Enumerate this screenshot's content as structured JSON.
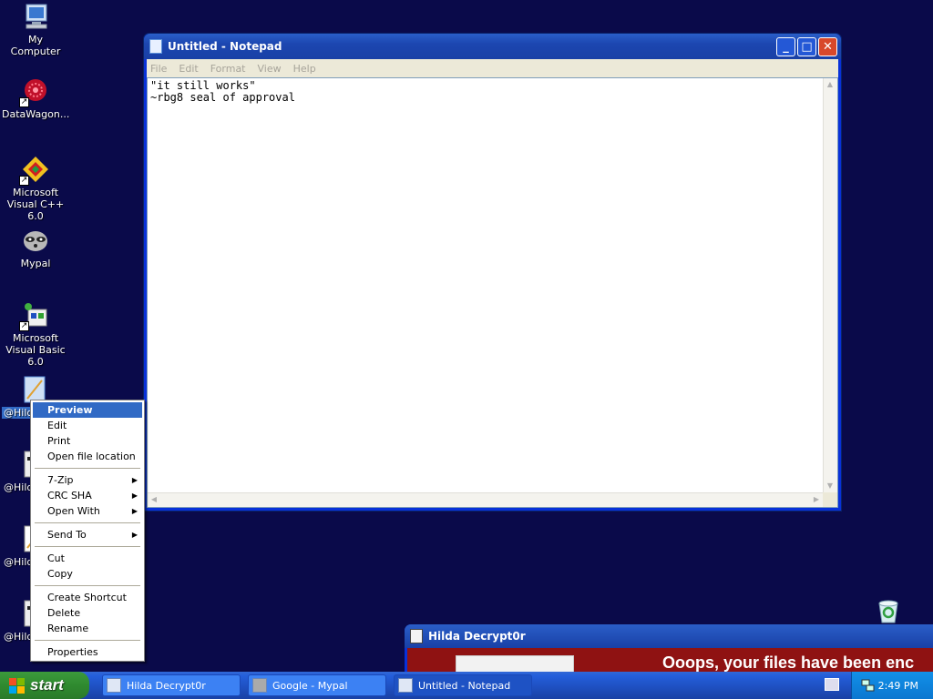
{
  "desktop": {
    "icons": [
      {
        "label": "My Computer",
        "icon": "my-computer-icon"
      },
      {
        "label": "DataWagon...",
        "icon": "datawagon-icon"
      },
      {
        "label": "Microsoft Visual C++ 6.0",
        "icon": "visual-cpp-icon"
      },
      {
        "label": "Mypal",
        "icon": "mypal-raccoon-icon"
      },
      {
        "label": "Microsoft Visual Basic 6.0",
        "icon": "visual-basic-icon"
      },
      {
        "label": "@Hilda",
        "icon": "hilda-file-icon"
      },
      {
        "label": "@Hild",
        "icon": "hilda-file-icon"
      },
      {
        "label": "@Hild",
        "icon": "hilda-file-icon"
      },
      {
        "label": "@Hild",
        "icon": "hilda-file-icon"
      }
    ]
  },
  "notepad": {
    "title": "Untitled - Notepad",
    "menu": [
      "File",
      "Edit",
      "Format",
      "View",
      "Help"
    ],
    "text": "\"it still works\"\n~rbg8 seal of approval",
    "controls": {
      "minimize": "_",
      "maximize": "□",
      "close": "✕"
    }
  },
  "context_menu": {
    "groups": [
      [
        "Preview",
        "Edit",
        "Print",
        "Open file location"
      ],
      [
        "7-Zip",
        "CRC SHA",
        "Open With"
      ],
      [
        "Send To"
      ],
      [
        "Cut",
        "Copy"
      ],
      [
        "Create Shortcut",
        "Delete",
        "Rename"
      ],
      [
        "Properties"
      ]
    ],
    "highlighted": "Preview",
    "submenu_arrow": "▶"
  },
  "hilda_window": {
    "title": "Hilda Decrypt0r",
    "message": "Ooops, your files have been enc"
  },
  "taskbar": {
    "start_label": "start",
    "buttons": [
      {
        "label": "Hilda Decrypt0r"
      },
      {
        "label": "Google - Mypal"
      },
      {
        "label": "Untitled - Notepad"
      }
    ],
    "clock": "2:49 PM"
  },
  "colors": {
    "desktop_bg": "#0a0a4a",
    "title_blue": "#0831d9",
    "highlight": "#316ac5",
    "ransom_red": "#8f1212"
  }
}
